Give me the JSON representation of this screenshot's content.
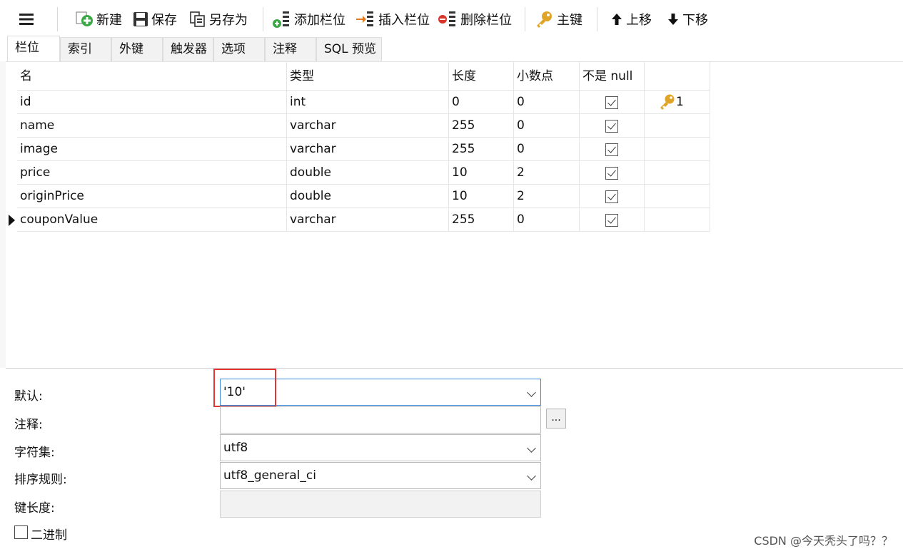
{
  "toolbar": {
    "new_label": "新建",
    "save_label": "保存",
    "save_as_label": "另存为",
    "add_column_label": "添加栏位",
    "insert_column_label": "插入栏位",
    "delete_column_label": "删除栏位",
    "primary_key_label": "主键",
    "move_up_label": "上移",
    "move_down_label": "下移"
  },
  "tabs": [
    {
      "label": "栏位"
    },
    {
      "label": "索引"
    },
    {
      "label": "外键"
    },
    {
      "label": "触发器"
    },
    {
      "label": "选项"
    },
    {
      "label": "注释"
    },
    {
      "label": "SQL 预览"
    }
  ],
  "grid": {
    "headers": {
      "name": "名",
      "type": "类型",
      "length": "长度",
      "decimals": "小数点",
      "not_null": "不是 null",
      "key": ""
    },
    "rows": [
      {
        "name": "id",
        "type": "int",
        "length": "0",
        "decimals": "0",
        "not_null": true,
        "key": "1"
      },
      {
        "name": "name",
        "type": "varchar",
        "length": "255",
        "decimals": "0",
        "not_null": true,
        "key": ""
      },
      {
        "name": "image",
        "type": "varchar",
        "length": "255",
        "decimals": "0",
        "not_null": true,
        "key": ""
      },
      {
        "name": "price",
        "type": "double",
        "length": "10",
        "decimals": "2",
        "not_null": true,
        "key": ""
      },
      {
        "name": "originPrice",
        "type": "double",
        "length": "10",
        "decimals": "2",
        "not_null": true,
        "key": ""
      },
      {
        "name": "couponValue",
        "type": "varchar",
        "length": "255",
        "decimals": "0",
        "not_null": true,
        "key": ""
      }
    ]
  },
  "properties": {
    "default_label": "默认:",
    "default_value": "'10'",
    "comment_label": "注释:",
    "comment_value": "",
    "comment_button": "...",
    "charset_label": "字符集:",
    "charset_value": "utf8",
    "collation_label": "排序规则:",
    "collation_value": "utf8_general_ci",
    "key_length_label": "键长度:",
    "key_length_value": "",
    "binary_label": "二进制",
    "binary_checked": false
  },
  "watermark": "CSDN @今天秃头了吗？？",
  "colors": {
    "key_icon": "#e0a526",
    "add_green": "#3aa845",
    "insert_orange": "#e27a1c",
    "delete_red": "#d9342b",
    "highlight_red": "#e53434",
    "focus_blue": "#3c8ad8"
  }
}
